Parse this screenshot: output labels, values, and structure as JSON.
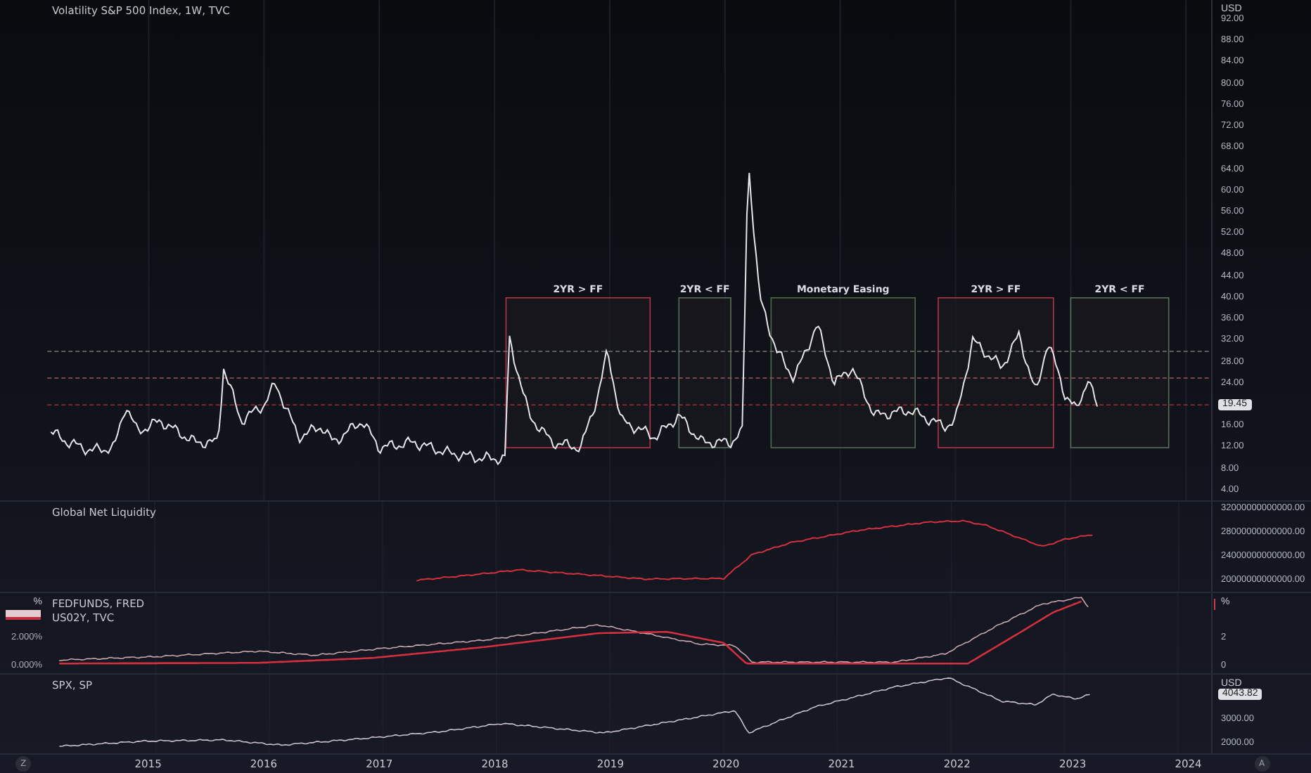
{
  "main": {
    "title": "Volatility S&P 500 Index, 1W, TVC",
    "currency": "USD",
    "axis": [
      {
        "kind": "tick",
        "text": "92.00"
      },
      {
        "kind": "tick",
        "text": "88.00"
      },
      {
        "kind": "tick",
        "text": "84.00"
      },
      {
        "kind": "tick",
        "text": "80.00"
      },
      {
        "kind": "tick",
        "text": "76.00"
      },
      {
        "kind": "tick",
        "text": "72.00"
      },
      {
        "kind": "tick",
        "text": "68.00"
      },
      {
        "kind": "tick",
        "text": "64.00"
      },
      {
        "kind": "tick",
        "text": "60.00"
      },
      {
        "kind": "tick",
        "text": "56.00"
      },
      {
        "kind": "tick",
        "text": "52.00"
      },
      {
        "kind": "tick",
        "text": "48.00"
      },
      {
        "kind": "tick",
        "text": "44.00"
      },
      {
        "kind": "tick",
        "text": "40.00"
      },
      {
        "kind": "tick",
        "text": "36.00"
      },
      {
        "kind": "tick",
        "text": "32.00"
      },
      {
        "kind": "tick",
        "text": "28.00"
      },
      {
        "kind": "tick",
        "text": "24.00"
      },
      {
        "kind": "badge",
        "text": "19.45"
      },
      {
        "kind": "tick",
        "text": "16.00"
      },
      {
        "kind": "tick",
        "text": "12.00"
      },
      {
        "kind": "tick",
        "text": "8.00"
      },
      {
        "kind": "tick",
        "text": "4.00"
      }
    ],
    "regions": [
      {
        "label": "2YR > FF",
        "color": "#b2364a"
      },
      {
        "label": "2YR < FF",
        "color": "#5a6e58"
      },
      {
        "label": "Monetary Easing",
        "color": "#4e6a4c"
      },
      {
        "label": "2YR > FF",
        "color": "#b2364a"
      },
      {
        "label": "2YR < FF",
        "color": "#5a6e58"
      }
    ]
  },
  "liquidity": {
    "title": "Global Net Liquidity",
    "axis": [
      "32000000000000.00",
      "28000000000000.00",
      "24000000000000.00",
      "20000000000000.00"
    ]
  },
  "rates": {
    "legend": [
      "FEDFUNDS, FRED",
      "US02Y, TVC"
    ],
    "left_unit": "%",
    "left_axis": [
      "2.000%",
      "0.000%"
    ],
    "right_unit": "%",
    "right_axis": [
      "2",
      "0"
    ]
  },
  "spx": {
    "title": "SPX, SP",
    "currency": "USD",
    "last_price": "4043.82",
    "axis": [
      "3000.00",
      "2000.00"
    ]
  },
  "time_axis": [
    "2015",
    "2016",
    "2017",
    "2018",
    "2019",
    "2020",
    "2021",
    "2022",
    "2023",
    "2024"
  ],
  "buttons": {
    "left": "Z",
    "right": "A"
  }
}
